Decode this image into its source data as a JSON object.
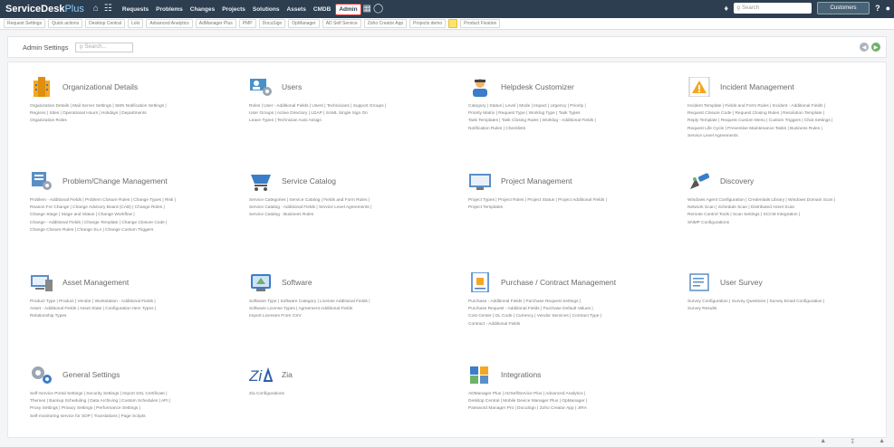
{
  "app": {
    "brand": "ServiceDesk",
    "brand_suffix": "Plus"
  },
  "topbar": {
    "home_icon": "home-icon",
    "nav": [
      "Requests",
      "Problems",
      "Changes",
      "Projects",
      "Solutions",
      "Assets",
      "CMDB",
      "Admin",
      "Reports"
    ],
    "active_nav": "Admin",
    "search_placeholder": "Search",
    "user_button": "Customers"
  },
  "quick_tabs": [
    "Request Settings",
    "Quick actions",
    "Desktop Central",
    "Lolo",
    "Advanced Analytics",
    "AdManager Plus",
    "PMP",
    "DocuSign",
    "OpManager",
    "AD Self Service",
    "Zoho Creator App",
    "Projects demo",
    "",
    "Product Fixation"
  ],
  "subbar": {
    "title": "Admin Settings",
    "search_placeholder": "Search..."
  },
  "accent": "#2d3e50",
  "cards": [
    {
      "title": "Organizational Details",
      "icon": "building-icon",
      "links": [
        "Organization Details | Mail Server Settings | SMS Notification Settings |",
        "Regions | Sites | Operational Hours | Holidays | Departments",
        "Organization Roles"
      ]
    },
    {
      "title": "Users",
      "icon": "users-icon",
      "links": [
        "Roles | User - Additional Fields | Users | Technicians | Support Groups |",
        "User Groups | Active Directory | LDAP | SAML Single Sign On",
        "Leave Types | Technician Auto Assign"
      ]
    },
    {
      "title": "Helpdesk Customizer",
      "icon": "helpdesk-icon",
      "links": [
        "Category | Status | Level | Mode | Impact | Urgency | Priority |",
        "Priority Matrix | Request Type | Worklog Type | Task Types",
        "Task Templates | Task Closing Rules | Worklog - Additional Fields |",
        "Notification Rules | Checklists"
      ]
    },
    {
      "title": "Incident Management",
      "icon": "incident-icon",
      "links": [
        "Incident Template | Fields and Form Rules | Incident - Additional Fields |",
        "Request Closure Code | Request Closing Rules | Resolution Template |",
        "Reply Template | Request Custom Menu | Custom Triggers | Chat Settings |",
        "Request Life Cycle | Preventive Maintenance Tasks | Business Rules |",
        "Service Level Agreements"
      ]
    },
    {
      "title": "Problem/Change Management",
      "icon": "problem-change-icon",
      "links": [
        "Problem - Additional Fields | Problem Closure Rules | Change Types | Risk |",
        "Reason For Change | Change Advisory Board (CAB) | Change Roles |",
        "Change Stage | Stage and Status | Change Workflow |",
        "Change - Additional Fields | Change Template | Change Closure Code |",
        "Change Closure Rules | Change SLA | Change Custom Triggers"
      ]
    },
    {
      "title": "Service Catalog",
      "icon": "catalog-icon",
      "links": [
        "Service Categories | Service Catalog | Fields and Form Rules |",
        "Service Catalog - Additional Fields | Service Level Agreements |",
        "Service Catalog - Business Rules"
      ]
    },
    {
      "title": "Project Management",
      "icon": "project-icon",
      "links": [
        "Project Types | Project Roles | Project Status | Project Additional Fields |",
        "Project Templates"
      ]
    },
    {
      "title": "Discovery",
      "icon": "discovery-icon",
      "links": [
        "Windows Agent Configuration | Credentials Library | Windows Domain Scan |",
        "Network Scan | Schedule Scan | Distributed Asset Scan",
        "Remote Control Tools | Scan Settings | SCCM Integration |",
        "SNMP Configurations"
      ]
    },
    {
      "title": "Asset Management",
      "icon": "asset-icon",
      "links": [
        "Product Type | Product | Vendor | Workstation - Additional Fields |",
        "Asset - Additional Fields | Asset State | Configuration Item Types |",
        "Relationship Types"
      ]
    },
    {
      "title": "Software",
      "icon": "software-icon",
      "links": [
        "Software Type | Software Category | License Additional Fields |",
        "Software License Types | Agreement Additional Fields",
        "Import Licenses From CSV"
      ]
    },
    {
      "title": "Purchase / Contract Management",
      "icon": "purchase-icon",
      "links": [
        "Purchase - Additional Fields | Purchase Request Settings |",
        "Purchase Request - Additional Fields | Purchase Default Values |",
        "Cost Center | GL Code | Currency | Vendor Services | Contract Type |",
        "Contract - Additional Fields"
      ]
    },
    {
      "title": "User Survey",
      "icon": "survey-icon",
      "links": [
        "Survey Configuration | Survey Questions | Survey Email Configuration |",
        "Survey Results"
      ]
    },
    {
      "title": "General Settings",
      "icon": "general-settings-icon",
      "links": [
        "Self-Service Portal Settings | Security Settings | Import SSL Certificate |",
        "Themes | Backup Scheduling | Data Archiving | Custom Schedules | API |",
        "Proxy Settings | Privacy Settings | Performance Settings |",
        "Self-monitoring service for SDP | Translations | Page Scripts"
      ]
    },
    {
      "title": "Zia",
      "icon": "zia-icon",
      "links": [
        "Zia Configurations"
      ]
    },
    {
      "title": "Integrations",
      "icon": "integrations-icon",
      "links": [
        "ADManager Plus | ADSelfService Plus | Advanced Analytics |",
        "Desktop Central | Mobile Device Manager Plus | OpManager |",
        "Password Manager Pro | DocuSign | Zoho Creator App | JIRA"
      ]
    }
  ],
  "footer_icons": [
    "feedback-icon",
    "download-icon",
    "info-icon"
  ]
}
